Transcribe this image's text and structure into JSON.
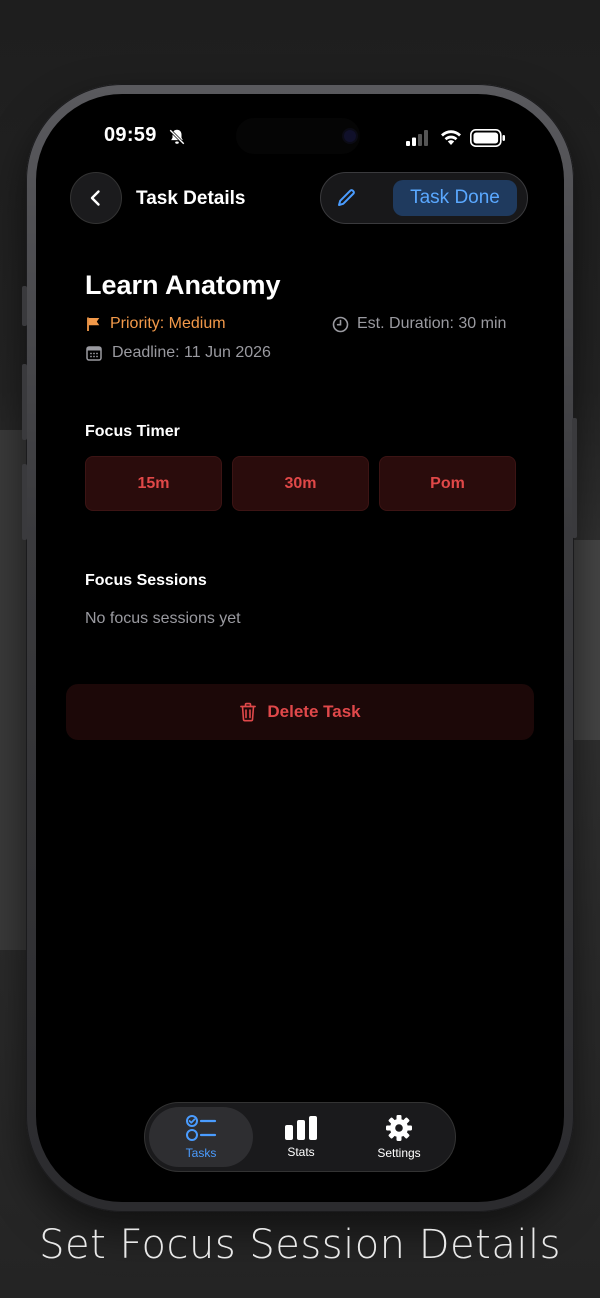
{
  "status_bar": {
    "time": "09:59"
  },
  "header": {
    "title": "Task Details",
    "done_label": "Task Done"
  },
  "task": {
    "title": "Learn Anatomy",
    "priority": "Priority: Medium",
    "duration": "Est. Duration: 30 min",
    "deadline": "Deadline: 11 Jun 2026"
  },
  "focus_timer": {
    "label": "Focus Timer",
    "options": [
      "15m",
      "30m",
      "Pom"
    ]
  },
  "focus_sessions": {
    "label": "Focus Sessions",
    "empty_text": "No focus sessions yet"
  },
  "delete_label": "Delete Task",
  "tabbar": {
    "tabs": [
      {
        "label": "Tasks",
        "icon": "tasks-list-icon",
        "active": true
      },
      {
        "label": "Stats",
        "icon": "bar-chart-icon",
        "active": false
      },
      {
        "label": "Settings",
        "icon": "gear-icon",
        "active": false
      }
    ]
  },
  "caption": "Set Focus Session Details",
  "colors": {
    "accent_blue": "#4a9cff",
    "priority_orange": "#f2994a",
    "danger_red": "#e04848",
    "screen_bg": "#000000"
  }
}
